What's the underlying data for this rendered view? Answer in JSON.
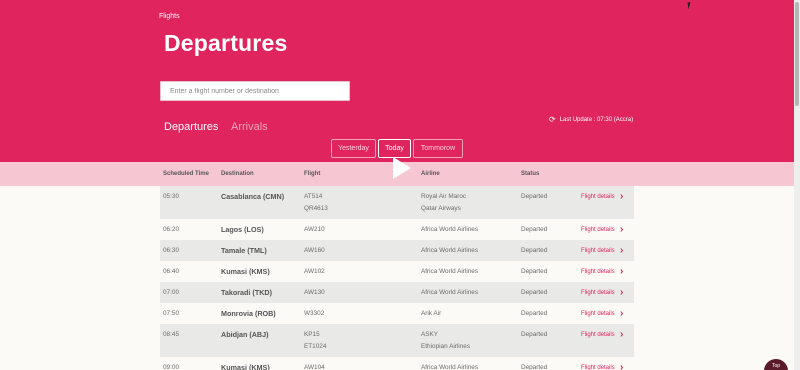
{
  "header": {
    "breadcrumb": "Flights",
    "title": "Departures",
    "search_placeholder": "Enter a flight number or destination",
    "tabs": {
      "departures": "Departures",
      "arrivals": "Arrivals"
    },
    "last_update": "Last Update : 07:30 (Accra)"
  },
  "day_buttons": {
    "yesterday": "Yesterday",
    "today": "Today",
    "tomorrow": "Tommorow"
  },
  "table": {
    "columns": {
      "time": "Scheduled Time",
      "destination": "Destination",
      "flight": "Flight",
      "airline": "Airline",
      "status": "Status"
    },
    "link_label": "Flight details",
    "rows": [
      {
        "time": "05:30",
        "destination": "Casablanca (CMN)",
        "flights": [
          "AT514",
          "QR4613"
        ],
        "airlines": [
          "Royal Air Maroc",
          "Qatar Airways"
        ],
        "status": "Departed"
      },
      {
        "time": "06:20",
        "destination": "Lagos (LOS)",
        "flights": [
          "AW210"
        ],
        "airlines": [
          "Africa World Airlines"
        ],
        "status": "Departed"
      },
      {
        "time": "06:30",
        "destination": "Tamale (TML)",
        "flights": [
          "AW160"
        ],
        "airlines": [
          "Africa World Airlines"
        ],
        "status": "Departed"
      },
      {
        "time": "06:40",
        "destination": "Kumasi (KMS)",
        "flights": [
          "AW102"
        ],
        "airlines": [
          "Africa World Airlines"
        ],
        "status": "Departed"
      },
      {
        "time": "07:00",
        "destination": "Takoradi (TKD)",
        "flights": [
          "AW130"
        ],
        "airlines": [
          "Africa World Airlines"
        ],
        "status": "Departed"
      },
      {
        "time": "07:50",
        "destination": "Monrovia (ROB)",
        "flights": [
          "W3302"
        ],
        "airlines": [
          "Arik Air"
        ],
        "status": "Departed"
      },
      {
        "time": "08:45",
        "destination": "Abidjan (ABJ)",
        "flights": [
          "KP15",
          "ET1024"
        ],
        "airlines": [
          "ASKY",
          "Ethiopian Airlines"
        ],
        "status": "Departed"
      },
      {
        "time": "09:00",
        "destination": "Kumasi (KMS)",
        "flights": [
          "AW104"
        ],
        "airlines": [
          "Africa World Airlines"
        ],
        "status": "Departed"
      }
    ]
  },
  "top_button": "Top",
  "colors": {
    "brand": "#e0245e",
    "band": "#f7c6d3",
    "row_alt": "#e9eae8"
  },
  "icons": [
    "refresh-icon",
    "play-icon",
    "chevron-right-icon",
    "cursor-icon"
  ]
}
